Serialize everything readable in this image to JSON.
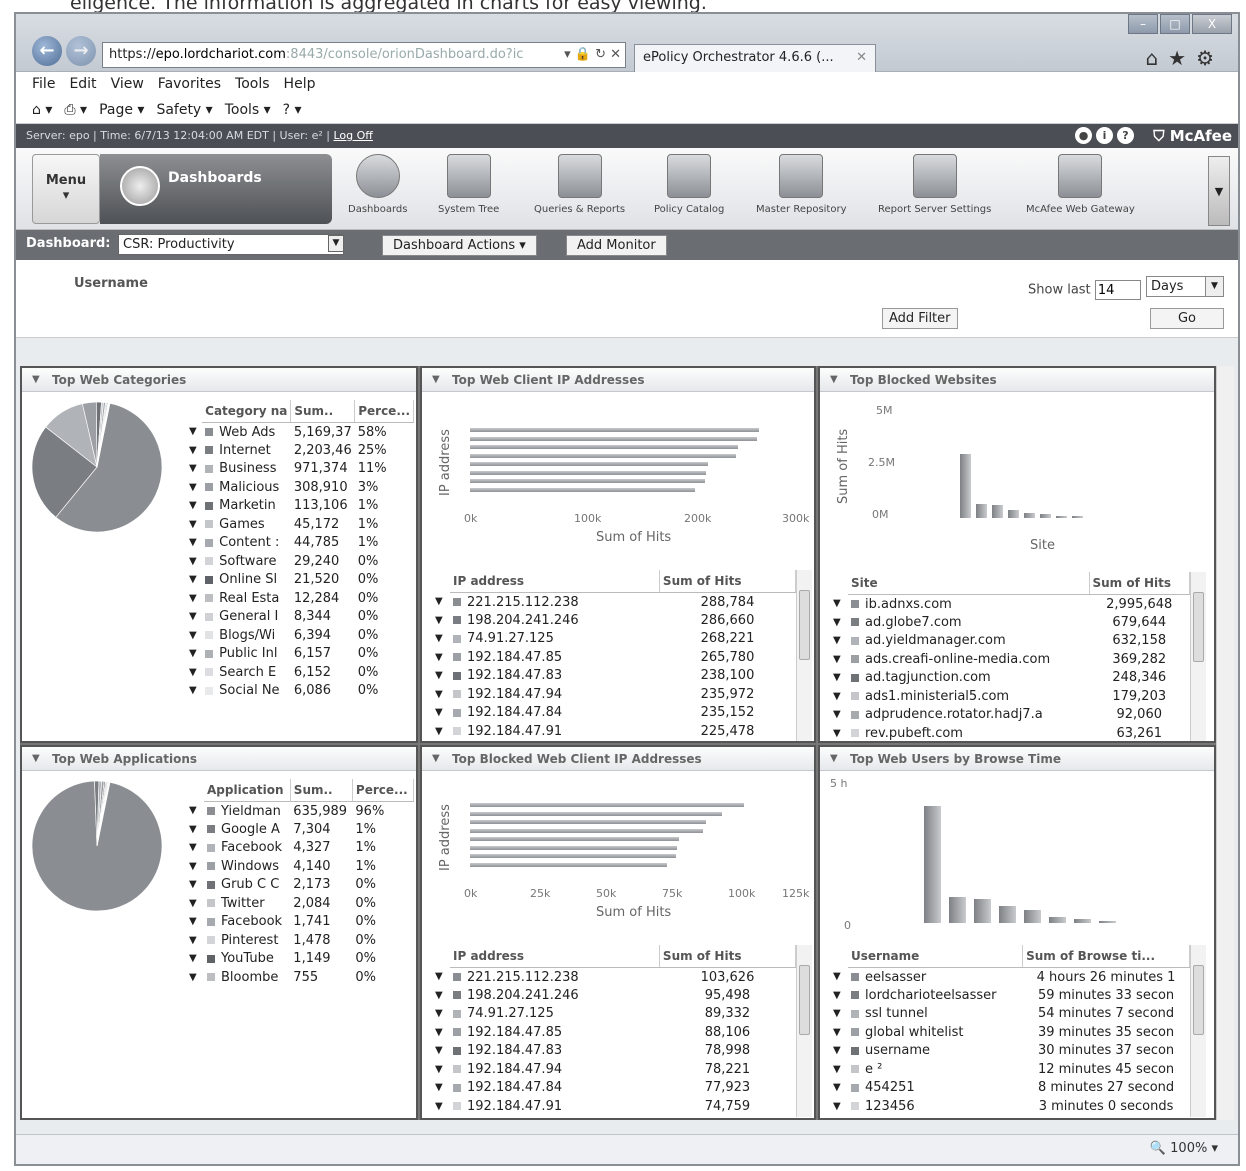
{
  "page_caption": "eligence. The information is aggregated in charts for easy viewing.",
  "browser": {
    "url_host": "https://",
    "url_domain": "epo.lordchariot.com",
    "url_rest": ":8443/console/orionDashboard.do?ic",
    "tab_title": "ePolicy Orchestrator 4.6.6 (...",
    "menu": [
      "File",
      "Edit",
      "View",
      "Favorites",
      "Tools",
      "Help"
    ],
    "commands": [
      "Page ▾",
      "Safety ▾",
      "Tools ▾"
    ],
    "zoom": "100%"
  },
  "server_bar": {
    "info": "Server: epo | Time: 6/7/13 12:04:00 AM EDT | User: e² |",
    "logoff": "Log Off",
    "brand": "McAfee"
  },
  "icon_bar": {
    "menu_label": "Menu",
    "current": "Dashboards",
    "items": [
      "Dashboards",
      "System Tree",
      "Queries & Reports",
      "Policy Catalog",
      "Master Repository",
      "Report Server Settings",
      "McAfee Web Gateway"
    ]
  },
  "dashboard_bar": {
    "label": "Dashboard:",
    "selected": "CSR: Productivity",
    "actions": "Dashboard Actions",
    "add_monitor": "Add Monitor"
  },
  "filter": {
    "field": "Username",
    "show_last_label": "Show last",
    "show_last_value": "14",
    "unit": "Days",
    "add_filter": "Add Filter",
    "go": "Go"
  },
  "panels": {
    "web_categories": {
      "title": "Top Web Categories",
      "columns": [
        "Category na",
        "Sum..",
        "Perce..."
      ],
      "rows": [
        [
          "Web Ads",
          "5,169,37",
          "58%"
        ],
        [
          "Internet",
          "2,203,46",
          "25%"
        ],
        [
          "Business",
          "971,374",
          "11%"
        ],
        [
          "Malicious",
          "308,910",
          "3%"
        ],
        [
          "Marketin",
          "113,106",
          "1%"
        ],
        [
          "Games",
          "45,172",
          "1%"
        ],
        [
          "Content :",
          "44,785",
          "1%"
        ],
        [
          "Software",
          "29,240",
          "0%"
        ],
        [
          "Online Sl",
          "21,520",
          "0%"
        ],
        [
          "Real Esta",
          "12,284",
          "0%"
        ],
        [
          "General I",
          "8,344",
          "0%"
        ],
        [
          "Blogs/Wi",
          "6,394",
          "0%"
        ],
        [
          "Public Inl",
          "6,157",
          "0%"
        ],
        [
          "Search E",
          "6,152",
          "0%"
        ],
        [
          "Social Ne",
          "6,086",
          "0%"
        ]
      ]
    },
    "web_client_ips": {
      "title": "Top Web Client IP Addresses",
      "ylabel": "IP address",
      "xlabel": "Sum of Hits",
      "ticks": [
        "0k",
        "100k",
        "200k",
        "300k"
      ],
      "columns": [
        "IP address",
        "Sum of Hits"
      ],
      "rows": [
        [
          "221.215.112.238",
          "288,784"
        ],
        [
          "198.204.241.246",
          "286,660"
        ],
        [
          "74.91.27.125",
          "268,221"
        ],
        [
          "192.184.47.85",
          "265,780"
        ],
        [
          "192.184.47.83",
          "238,100"
        ],
        [
          "192.184.47.94",
          "235,972"
        ],
        [
          "192.184.47.84",
          "235,152"
        ],
        [
          "192.184.47.91",
          "225,478"
        ]
      ]
    },
    "blocked_websites": {
      "title": "Top Blocked Websites",
      "ylabel": "Sum of Hits",
      "xlabel": "Site",
      "ticks": [
        "5M",
        "2.5M",
        "0M"
      ],
      "columns": [
        "Site",
        "Sum of Hits"
      ],
      "rows": [
        [
          "ib.adnxs.com",
          "2,995,648"
        ],
        [
          "ad.globe7.com",
          "679,644"
        ],
        [
          "ad.yieldmanager.com",
          "632,158"
        ],
        [
          "ads.creafi-online-media.com",
          "369,282"
        ],
        [
          "ad.tagjunction.com",
          "248,346"
        ],
        [
          "ads1.ministerial5.com",
          "179,203"
        ],
        [
          "adprudence.rotator.hadj7.a",
          "92,060"
        ],
        [
          "rev.pubeft.com",
          "63,261"
        ]
      ]
    },
    "web_applications": {
      "title": "Top Web Applications",
      "columns": [
        "Application",
        "Sum..",
        "Perce..."
      ],
      "rows": [
        [
          "Yieldman",
          "635,989",
          "96%"
        ],
        [
          "Google A",
          "7,304",
          "1%"
        ],
        [
          "Facebook",
          "4,327",
          "1%"
        ],
        [
          "Windows",
          "4,140",
          "1%"
        ],
        [
          "Grub C C",
          "2,173",
          "0%"
        ],
        [
          "Twitter",
          "2,084",
          "0%"
        ],
        [
          "Facebook",
          "1,741",
          "0%"
        ],
        [
          "Pinterest",
          "1,478",
          "0%"
        ],
        [
          "YouTube",
          "1,149",
          "0%"
        ],
        [
          "Bloombe",
          "755",
          "0%"
        ]
      ]
    },
    "blocked_client_ips": {
      "title": "Top Blocked Web Client IP Addresses",
      "ylabel": "IP address",
      "xlabel": "Sum of Hits",
      "ticks": [
        "0k",
        "25k",
        "50k",
        "75k",
        "100k",
        "125k"
      ],
      "columns": [
        "IP address",
        "Sum of Hits"
      ],
      "rows": [
        [
          "221.215.112.238",
          "103,626"
        ],
        [
          "198.204.241.246",
          "95,498"
        ],
        [
          "74.91.27.125",
          "89,332"
        ],
        [
          "192.184.47.85",
          "88,106"
        ],
        [
          "192.184.47.83",
          "78,998"
        ],
        [
          "192.184.47.94",
          "78,221"
        ],
        [
          "192.184.47.84",
          "77,923"
        ],
        [
          "192.184.47.91",
          "74,759"
        ]
      ]
    },
    "browse_time": {
      "title": "Top Web Users by Browse Time",
      "ticks": [
        "5 h",
        "0"
      ],
      "columns": [
        "Username",
        "Sum of Browse ti..."
      ],
      "rows": [
        [
          "eelsasser",
          "4 hours 26 minutes 1"
        ],
        [
          "lordcharioteelsasser",
          "59 minutes 33 secon"
        ],
        [
          "ssl tunnel",
          "54 minutes 7 second"
        ],
        [
          "global whitelist",
          "39 minutes 35 secon"
        ],
        [
          "username",
          "30 minutes 37 secon"
        ],
        [
          "e ²",
          "12 minutes 45 secon"
        ],
        [
          "454251",
          "8 minutes 27 second"
        ],
        [
          "123456",
          "3 minutes 0 seconds"
        ]
      ]
    }
  },
  "chart_data": [
    {
      "type": "pie",
      "title": "Top Web Categories",
      "categories": [
        "Web Ads",
        "Internet",
        "Business",
        "Malicious",
        "Marketin",
        "Games",
        "Content :",
        "Software",
        "Online Sl",
        "Real Esta",
        "General I",
        "Blogs/Wi",
        "Public Inl",
        "Search E",
        "Social Ne"
      ],
      "values": [
        5169370,
        2203460,
        971374,
        308910,
        113106,
        45172,
        44785,
        29240,
        21520,
        12284,
        8344,
        6394,
        6157,
        6152,
        6086
      ]
    },
    {
      "type": "bar",
      "orientation": "horizontal",
      "title": "Top Web Client IP Addresses",
      "xlabel": "Sum of Hits",
      "ylabel": "IP address",
      "xlim": [
        0,
        330000
      ],
      "categories": [
        "221.215.112.238",
        "198.204.241.246",
        "74.91.27.125",
        "192.184.47.85",
        "192.184.47.83",
        "192.184.47.94",
        "192.184.47.84",
        "192.184.47.91"
      ],
      "values": [
        288784,
        286660,
        268221,
        265780,
        238100,
        235972,
        235152,
        225478
      ]
    },
    {
      "type": "bar",
      "title": "Top Blocked Websites",
      "xlabel": "Site",
      "ylabel": "Sum of Hits",
      "ylim": [
        0,
        5000000
      ],
      "categories": [
        "ib.adnxs.com",
        "ad.globe7.com",
        "ad.yieldmanager.com",
        "ads.creafi-online-media.com",
        "ad.tagjunction.com",
        "ads1.ministerial5.com",
        "adprudence.rotator.hadj7.a",
        "rev.pubeft.com"
      ],
      "values": [
        2995648,
        679644,
        632158,
        369282,
        248346,
        179203,
        92060,
        63261
      ]
    },
    {
      "type": "pie",
      "title": "Top Web Applications",
      "categories": [
        "Yieldman",
        "Google A",
        "Facebook",
        "Windows",
        "Grub C C",
        "Twitter",
        "Facebook",
        "Pinterest",
        "YouTube",
        "Bloombe"
      ],
      "values": [
        635989,
        7304,
        4327,
        4140,
        2173,
        2084,
        1741,
        1478,
        1149,
        755
      ]
    },
    {
      "type": "bar",
      "orientation": "horizontal",
      "title": "Top Blocked Web Client IP Addresses",
      "xlabel": "Sum of Hits",
      "ylabel": "IP address",
      "xlim": [
        0,
        125000
      ],
      "categories": [
        "221.215.112.238",
        "198.204.241.246",
        "74.91.27.125",
        "192.184.47.85",
        "192.184.47.83",
        "192.184.47.94",
        "192.184.47.84",
        "192.184.47.91"
      ],
      "values": [
        103626,
        95498,
        89332,
        88106,
        78998,
        78221,
        77923,
        74759
      ]
    },
    {
      "type": "bar",
      "title": "Top Web Users by Browse Time",
      "ylabel": "",
      "ylim": [
        0,
        5
      ],
      "categories": [
        "eelsasser",
        "lordcharioteelsasser",
        "ssl tunnel",
        "global whitelist",
        "username",
        "e ²",
        "454251",
        "123456"
      ],
      "values": [
        4.44,
        0.99,
        0.9,
        0.66,
        0.51,
        0.21,
        0.14,
        0.05
      ]
    }
  ],
  "colors": {
    "pie_main": "#8a8d91",
    "pie_light": "#c4c6c9",
    "accent_bar": "#6a6d72"
  }
}
